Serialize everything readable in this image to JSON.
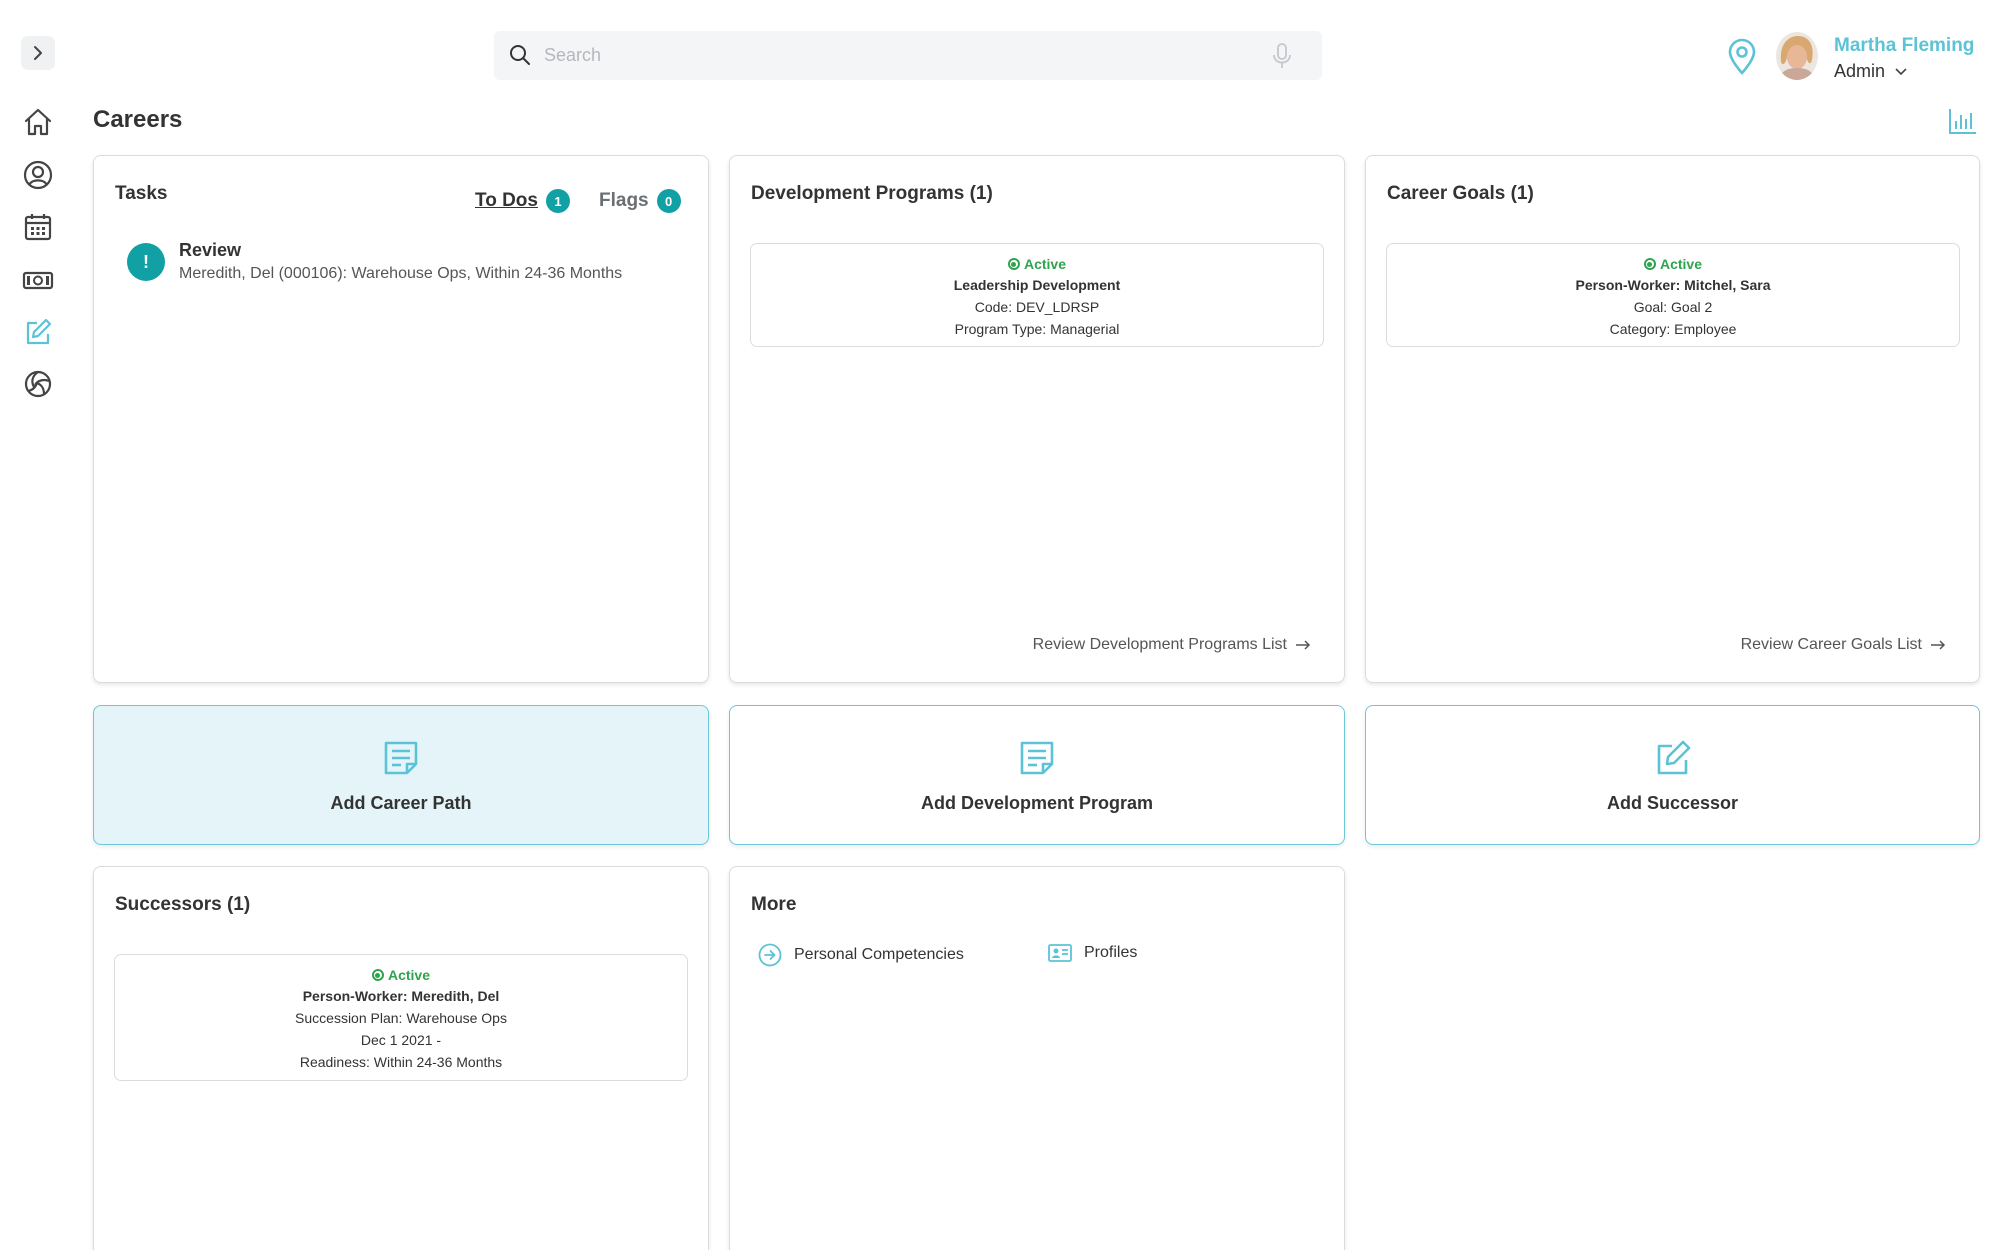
{
  "search": {
    "placeholder": "Search"
  },
  "user": {
    "name": "Martha Fleming",
    "role": "Admin"
  },
  "page": {
    "title": "Careers"
  },
  "tasks": {
    "title": "Tasks",
    "tabs": [
      {
        "label": "To Dos",
        "count": "1"
      },
      {
        "label": "Flags",
        "count": "0"
      }
    ],
    "items": [
      {
        "icon": "!",
        "title": "Review",
        "desc": "Meredith, Del (000106): Warehouse Ops, Within 24-36 Months"
      }
    ]
  },
  "dev_programs": {
    "title": "Development Programs (1)",
    "item": {
      "status": "Active",
      "name": "Leadership Development",
      "code": "Code: DEV_LDRSP",
      "type": "Program Type: Managerial"
    },
    "link": "Review Development Programs List"
  },
  "career_goals": {
    "title": "Career Goals (1)",
    "item": {
      "status": "Active",
      "worker": "Person-Worker: Mitchel, Sara",
      "goal": "Goal: Goal 2",
      "category": "Category: Employee"
    },
    "link": "Review Career Goals List"
  },
  "actions": [
    {
      "label": "Add Career Path"
    },
    {
      "label": "Add Development Program"
    },
    {
      "label": "Add Successor"
    }
  ],
  "successors": {
    "title": "Successors (1)",
    "item": {
      "status": "Active",
      "worker": "Person-Worker: Meredith, Del",
      "plan": "Succession Plan: Warehouse Ops",
      "date": "Dec 1 2021 -",
      "readiness": "Readiness: Within 24-36 Months"
    }
  },
  "more": {
    "title": "More",
    "links": [
      {
        "label": "Personal Competencies",
        "icon": "arrow-circle-icon"
      },
      {
        "label": "Profiles",
        "icon": "id-card-icon"
      }
    ]
  },
  "colors": {
    "accent": "#5cc3d7",
    "teal_badge": "#11a1a5",
    "active_green": "#2ea44f"
  }
}
